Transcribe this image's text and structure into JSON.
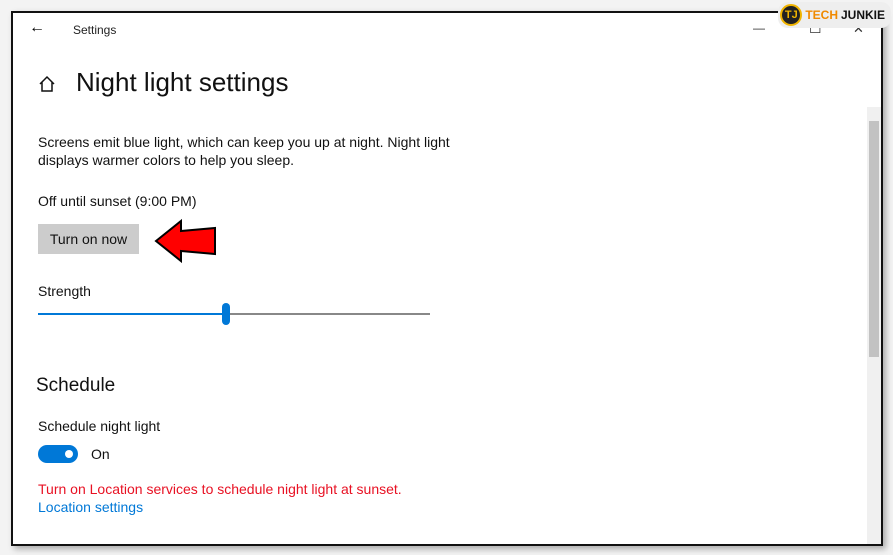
{
  "titlebar": {
    "app_title": "Settings",
    "minimize": "—",
    "maximize": "☐",
    "close": "✕",
    "back": "←"
  },
  "watermark": {
    "logo": "TJ",
    "prefix": "TECH",
    "suffix": "JUNKIE"
  },
  "page": {
    "title": "Night light settings",
    "description_line1": "Screens emit blue light, which can keep you up at night. Night light",
    "description_line2": "displays warmer colors to help you sleep.",
    "status": "Off until sunset (9:00 PM)",
    "turn_on_button": "Turn on now"
  },
  "strength": {
    "label": "Strength",
    "value_percent": 48
  },
  "schedule": {
    "heading": "Schedule",
    "toggle_label": "Schedule night light",
    "toggle_state": "On",
    "warning": "Turn on Location services to schedule night light at sunset.",
    "link": "Location settings"
  },
  "colors": {
    "accent": "#0078d7",
    "warning": "#e81123",
    "arrow": "#ff0000"
  }
}
